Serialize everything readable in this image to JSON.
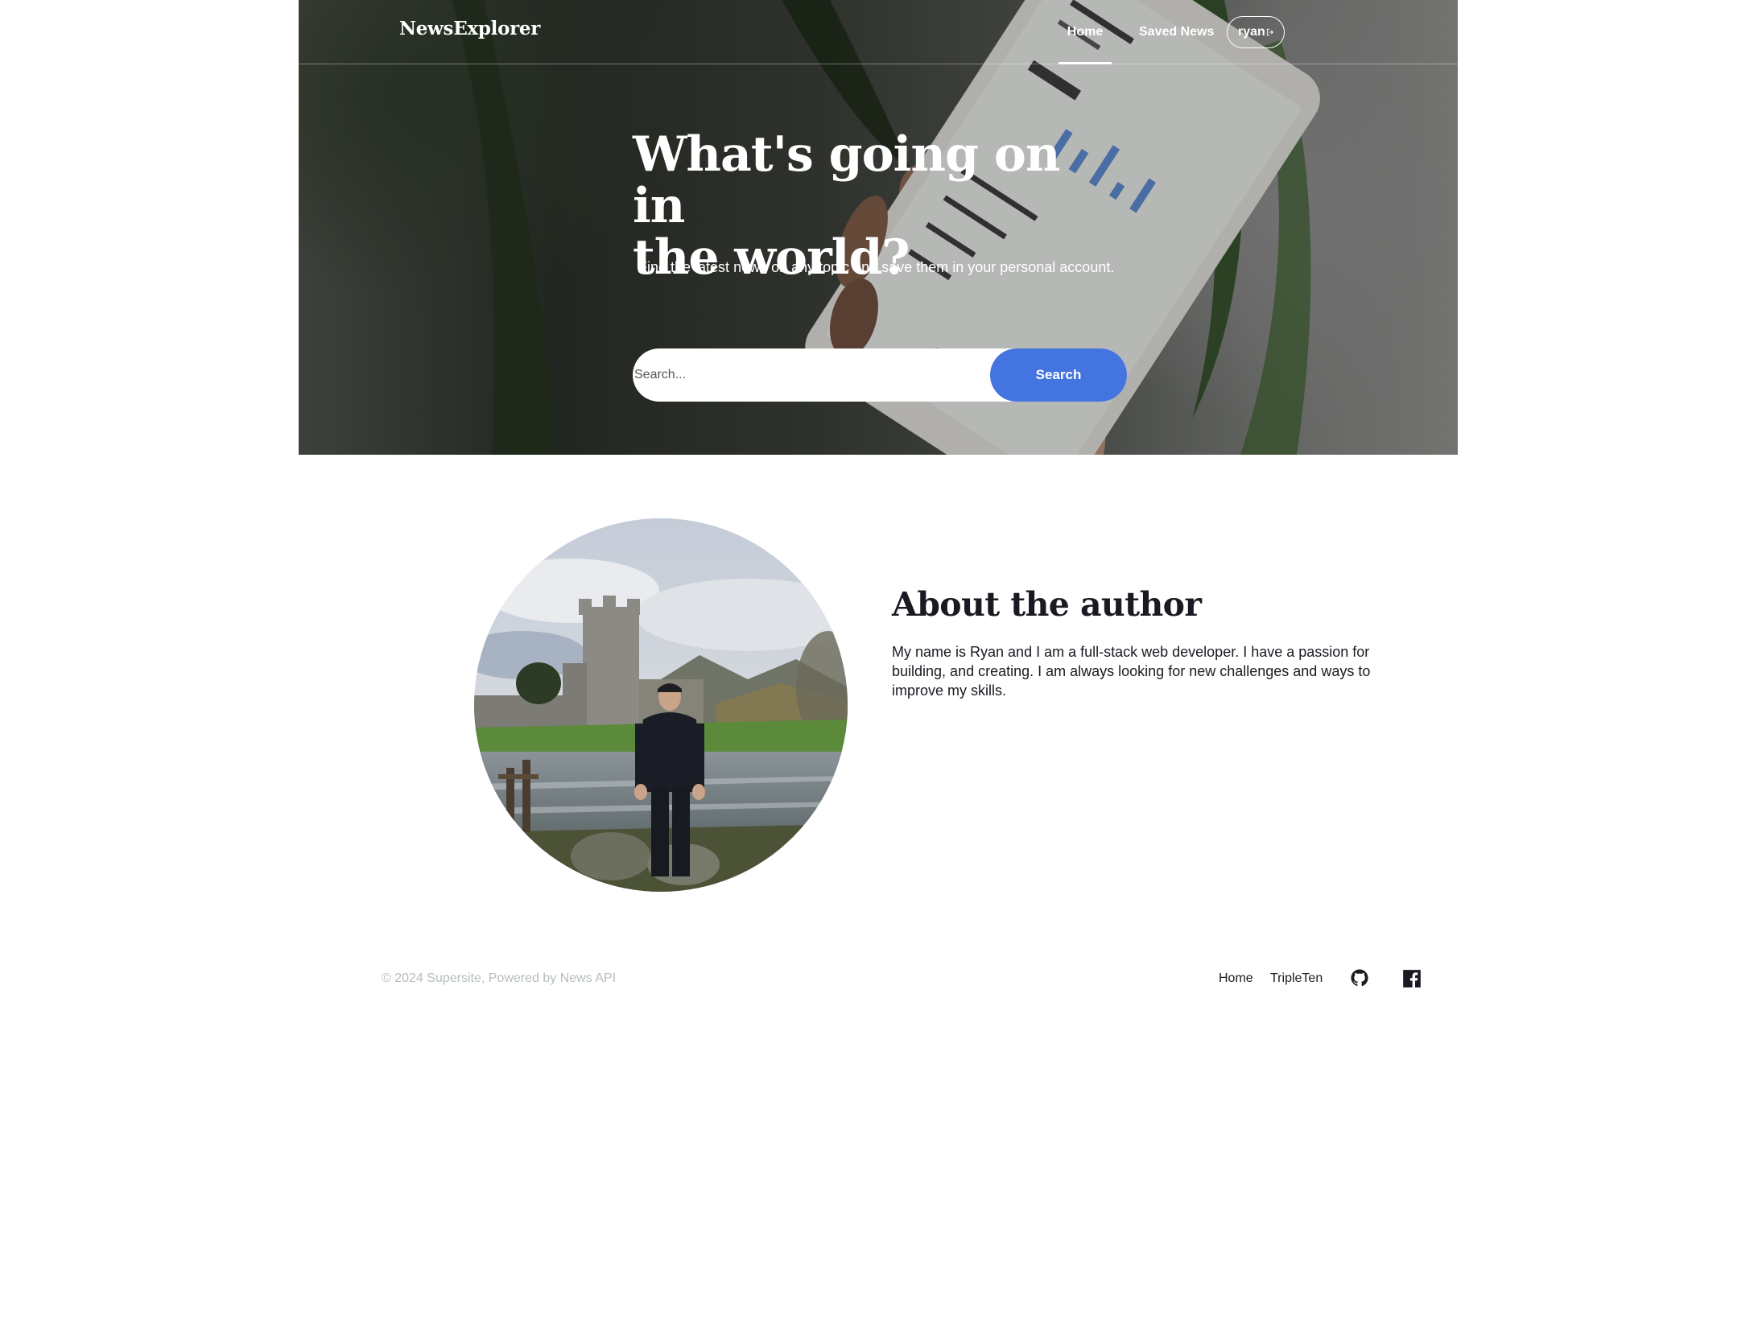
{
  "header": {
    "logo": "NewsExplorer",
    "nav": {
      "home": "Home",
      "saved_news": "Saved News"
    },
    "user": {
      "name": "ryan",
      "icon": "logout-icon"
    }
  },
  "hero": {
    "title_line1": "What's going on in",
    "title_line2": "the world?",
    "subtitle": "Find the latest news on any topic and save them in your personal account.",
    "search": {
      "placeholder": "Search...",
      "value": "",
      "button_label": "Search"
    }
  },
  "about": {
    "title": "About the author",
    "text": "My name is Ryan and I am a full-stack web developer. I have a passion for building, and creating. I am always looking for new challenges and ways to improve my skills.",
    "avatar_alt": "author photo"
  },
  "footer": {
    "copyright": "© 2024 Supersite, Powered by News API",
    "links": {
      "home": "Home",
      "tripleten": "TripleTen"
    },
    "social_icons": [
      "github-icon",
      "facebook-icon"
    ]
  },
  "colors": {
    "accent": "#4474df",
    "text_dark": "#1a1b22",
    "text_muted": "#b6bcbf"
  }
}
